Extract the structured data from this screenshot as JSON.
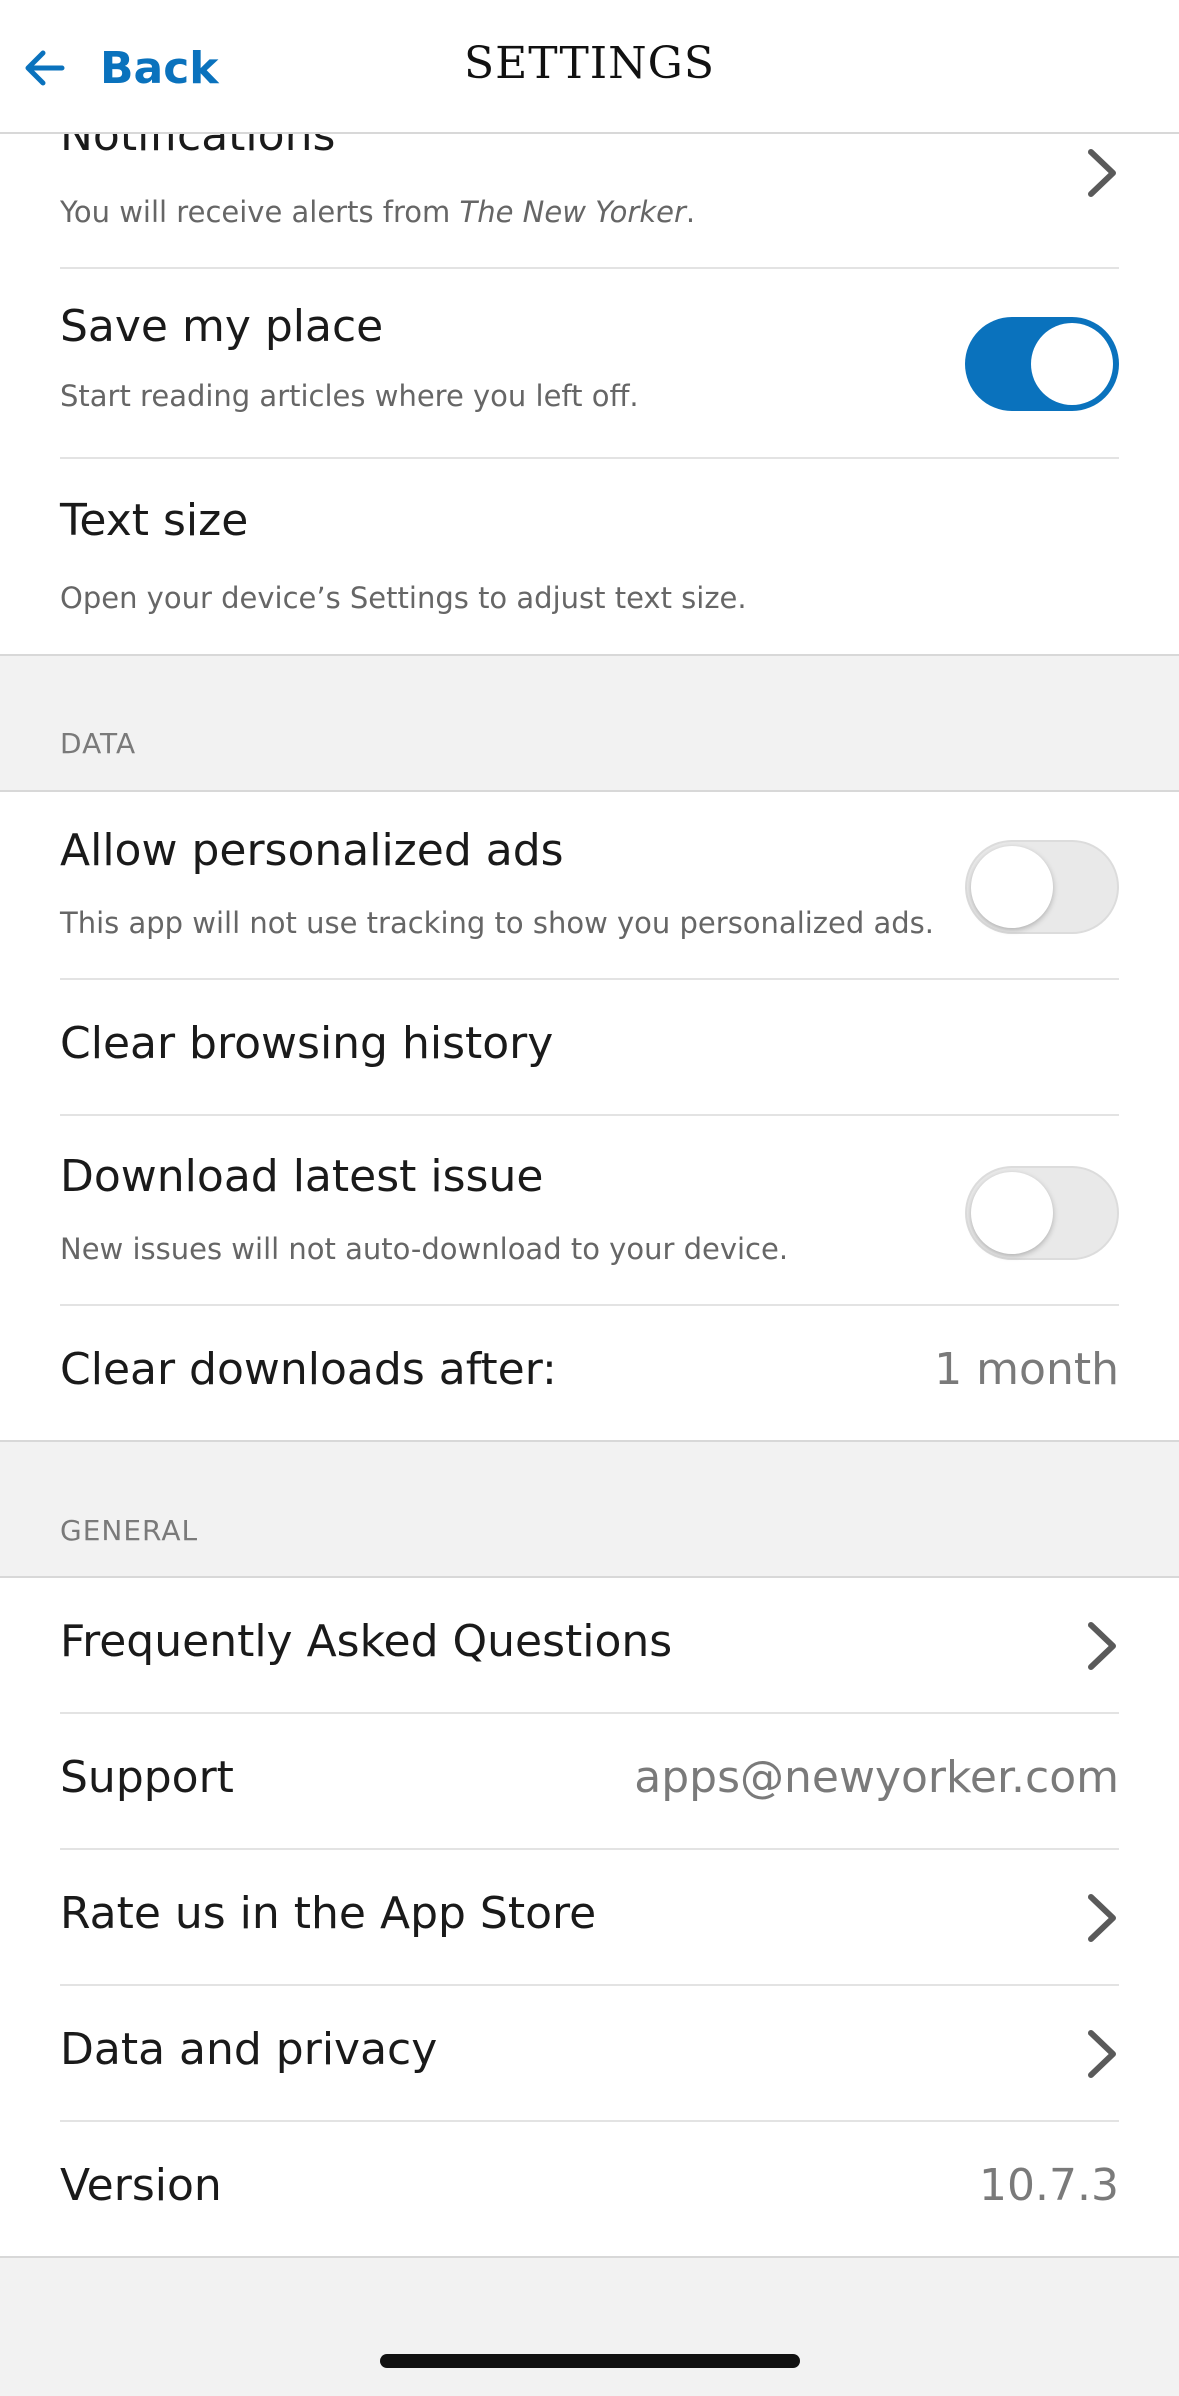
{
  "nav": {
    "back_label": "Back",
    "title": "SETTINGS"
  },
  "top_group": {
    "notifications": {
      "title": "Notifications",
      "subtitle_prefix": "You will receive alerts from ",
      "subtitle_publication": "The New Yorker",
      "subtitle_suffix": "."
    },
    "save_my_place": {
      "title": "Save my place",
      "subtitle": "Start reading articles where you left off.",
      "toggle_state": "on"
    },
    "text_size": {
      "title": "Text size",
      "subtitle": "Open your device’s Settings to adjust text size."
    }
  },
  "data_section": {
    "header": "DATA",
    "personalized_ads": {
      "title": "Allow personalized ads",
      "subtitle": "This app will not use tracking to show you personalized ads.",
      "toggle_state": "off"
    },
    "clear_history": {
      "title": "Clear browsing history"
    },
    "download_latest": {
      "title": "Download latest issue",
      "subtitle": "New issues will not auto-download to your device.",
      "toggle_state": "off"
    },
    "clear_downloads": {
      "title": "Clear downloads after:",
      "value": "1 month"
    }
  },
  "general_section": {
    "header": "GENERAL",
    "faq": {
      "title": "Frequently Asked Questions"
    },
    "support": {
      "title": "Support",
      "value": "apps@newyorker.com"
    },
    "rate": {
      "title": "Rate us in the App Store"
    },
    "privacy": {
      "title": "Data and privacy"
    },
    "version": {
      "title": "Version",
      "value": "10.7.3"
    }
  },
  "colors": {
    "accent": "#0a72bd",
    "background": "#f2f2f2",
    "row_background": "#ffffff"
  },
  "icons": [
    "back-arrow-icon",
    "chevron-right-icon"
  ]
}
